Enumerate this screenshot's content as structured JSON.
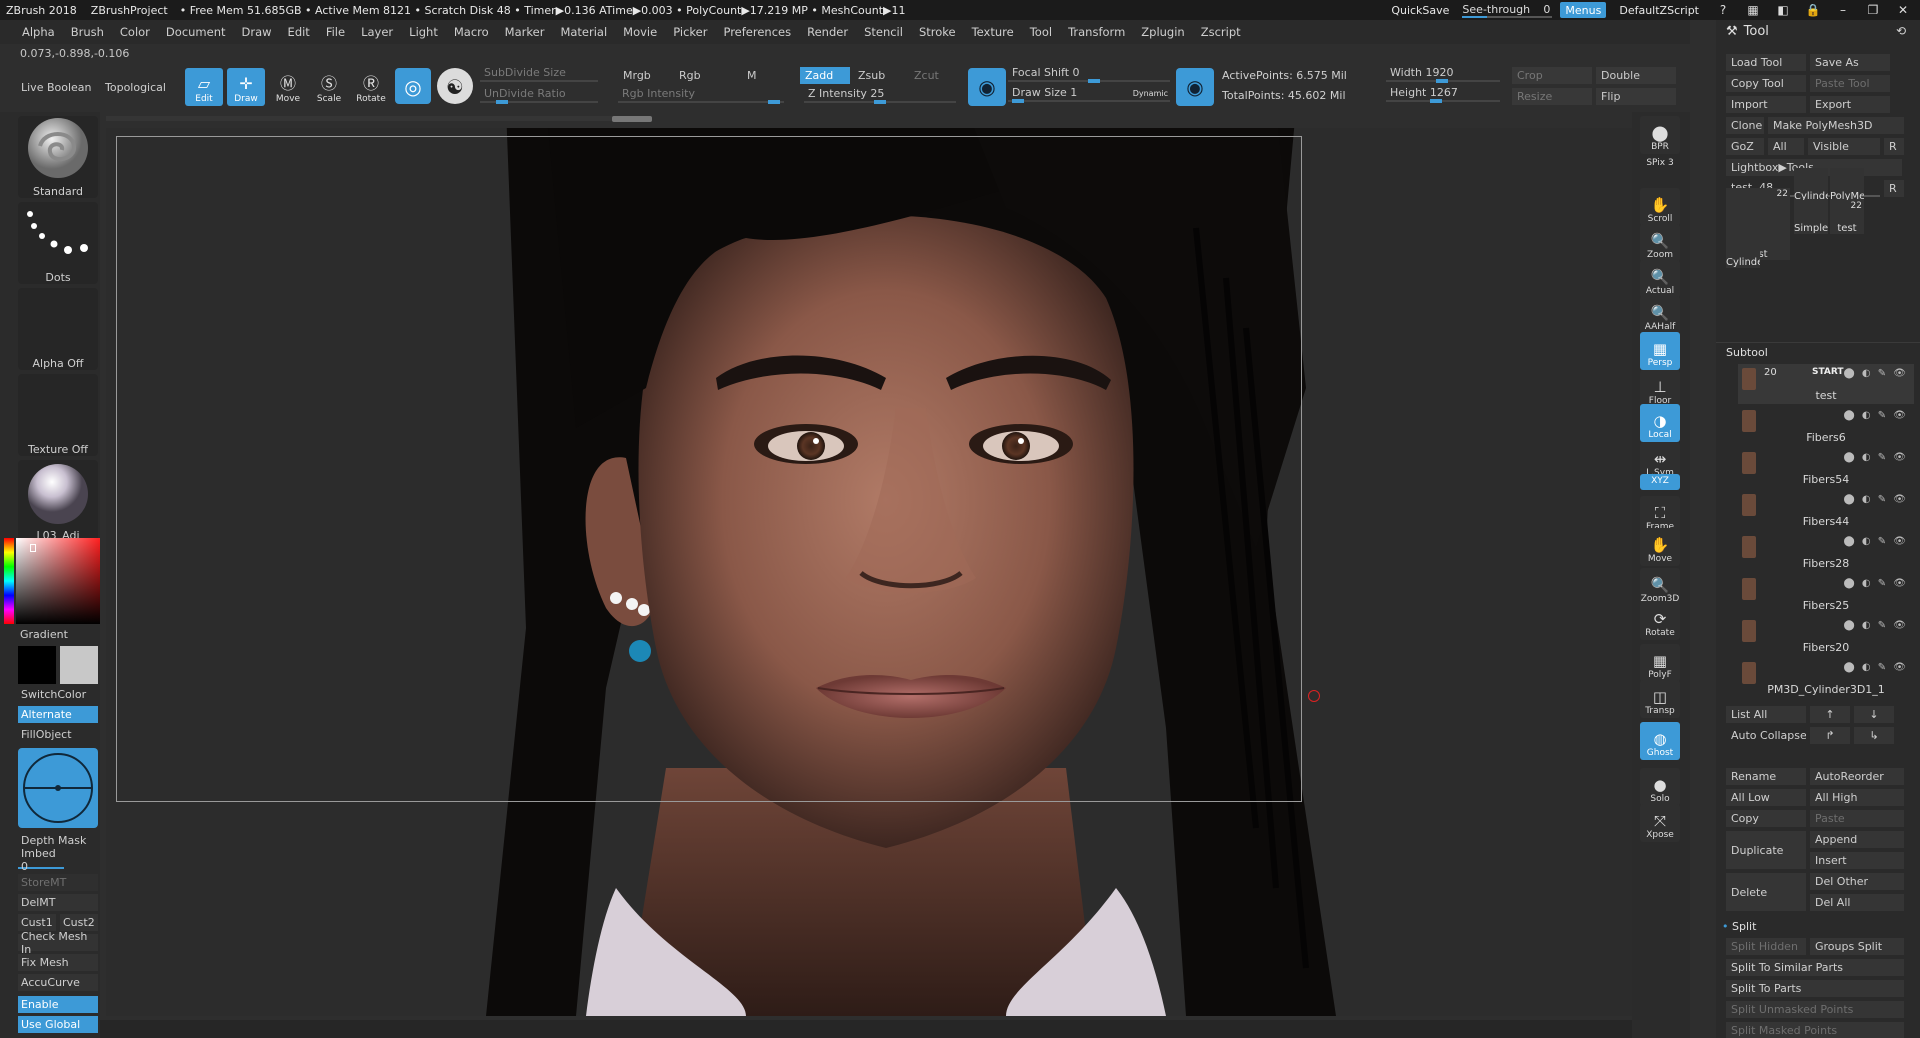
{
  "title_bar": {
    "app": "ZBrush 2018",
    "project": "ZBrushProject",
    "stats": "• Free Mem 51.685GB • Active Mem 8121 • Scratch Disk 48 • Timer▶0.136 ATime▶0.003 • PolyCount▶17.219 MP • MeshCount▶11",
    "quicksave": "QuickSave",
    "see_through": "See-through",
    "see_through_value": "0",
    "menus": "Menus",
    "script": "DefaultZScript"
  },
  "menu": [
    "Alpha",
    "Brush",
    "Color",
    "Document",
    "Draw",
    "Edit",
    "File",
    "Layer",
    "Light",
    "Macro",
    "Marker",
    "Material",
    "Movie",
    "Picker",
    "Preferences",
    "Render",
    "Stencil",
    "Stroke",
    "Texture",
    "Tool",
    "Transform",
    "Zplugin",
    "Zscript"
  ],
  "coords": "0.073,-0.898,-0.106",
  "shelf": {
    "live_boolean": "Live Boolean",
    "topological": "Topological",
    "edit": "Edit",
    "draw": "Draw",
    "move": "Move",
    "scale": "Scale",
    "rotate": "Rotate",
    "subdivide_size": "SubDivide Size",
    "undivide_ratio": "UnDivide Ratio",
    "mrgb": "Mrgb",
    "rgb": "Rgb",
    "m": "M",
    "rgb_intensity": "Rgb Intensity",
    "zadd": "Zadd",
    "zsub": "Zsub",
    "zcut": "Zcut",
    "z_intensity": "Z Intensity 25",
    "focal_shift": "Focal Shift 0",
    "draw_size": "Draw Size 1",
    "dynamic": "Dynamic",
    "active_points": "ActivePoints: 6.575 Mil",
    "total_points": "TotalPoints: 45.602 Mil",
    "width": "Width 1920",
    "height": "Height 1267",
    "crop": "Crop",
    "resize": "Resize",
    "double": "Double",
    "flip": "Flip"
  },
  "left": {
    "brush": "Standard",
    "stroke": "Dots",
    "alpha": "Alpha Off",
    "texture": "Texture Off",
    "material": "L03_Adj",
    "gradient": "Gradient",
    "switchcolor": "SwitchColor",
    "alternate": "Alternate",
    "fillobject": "FillObject",
    "depth_mask": "Depth Mask",
    "imbed": "Imbed 0",
    "storemt": "StoreMT",
    "delmt": "DelMT",
    "cust1": "Cust1",
    "cust2": "Cust2",
    "check_mesh": "Check Mesh In",
    "fix_mesh": "Fix Mesh",
    "accucurve": "AccuCurve",
    "enable": "Enable",
    "use_global": "Use Global"
  },
  "right_shelf": [
    "BPR",
    "SPix 3",
    "Scroll",
    "Zoom",
    "Actual",
    "AAHalf",
    "Persp",
    "Floor",
    "Local",
    "L.Sym",
    "XYZ",
    "Frame",
    "Move",
    "Zoom3D",
    "Rotate",
    "PolyF",
    "Transp",
    "Ghost",
    "Solo",
    "Xpose"
  ],
  "tool_palette": {
    "title": "Tool",
    "load_tool": "Load Tool",
    "save_as": "Save As",
    "copy_tool": "Copy Tool",
    "paste_tool": "Paste Tool",
    "import": "Import",
    "export": "Export",
    "clone": "Clone",
    "make_polymesh": "Make PolyMesh3D",
    "goz": "GoZ",
    "all": "All",
    "visible": "Visible",
    "r": "R",
    "lightbox": "Lightbox▶Tools",
    "current_tool": "test. 48",
    "thumbs": [
      {
        "name": "test",
        "count": "22"
      },
      {
        "name": "Cylinde",
        "count": ""
      },
      {
        "name": "PolyMe",
        "count": ""
      },
      {
        "name": "SimpleE",
        "count": ""
      },
      {
        "name": "test",
        "count": "22"
      },
      {
        "name": "Cylinde",
        "count": ""
      }
    ],
    "subtool_title": "Subtool",
    "subtools": [
      "test",
      "Fibers6",
      "Fibers54",
      "Fibers44",
      "Fibers28",
      "Fibers25",
      "Fibers20",
      "PM3D_Cylinder3D1_1"
    ],
    "subtool_top_count": "20",
    "subtool_top_flag": "START",
    "list_all": "List All",
    "auto_collapse": "Auto Collapse",
    "rename": "Rename",
    "autoreorder": "AutoReorder",
    "all_low": "All Low",
    "all_high": "All High",
    "copy": "Copy",
    "paste": "Paste",
    "duplicate": "Duplicate",
    "append": "Append",
    "insert": "Insert",
    "delete": "Delete",
    "del_other": "Del Other",
    "del_all": "Del All",
    "split": "Split",
    "split_hidden": "Split Hidden",
    "groups_split": "Groups Split",
    "split_similar": "Split To Similar Parts",
    "split_parts": "Split To Parts",
    "split_unmasked": "Split Unmasked Points",
    "split_masked": "Split Masked Points"
  },
  "colors": {
    "accent": "#3d9ad7",
    "background": "#2e2e2e",
    "panel": "#2a2a2a"
  }
}
